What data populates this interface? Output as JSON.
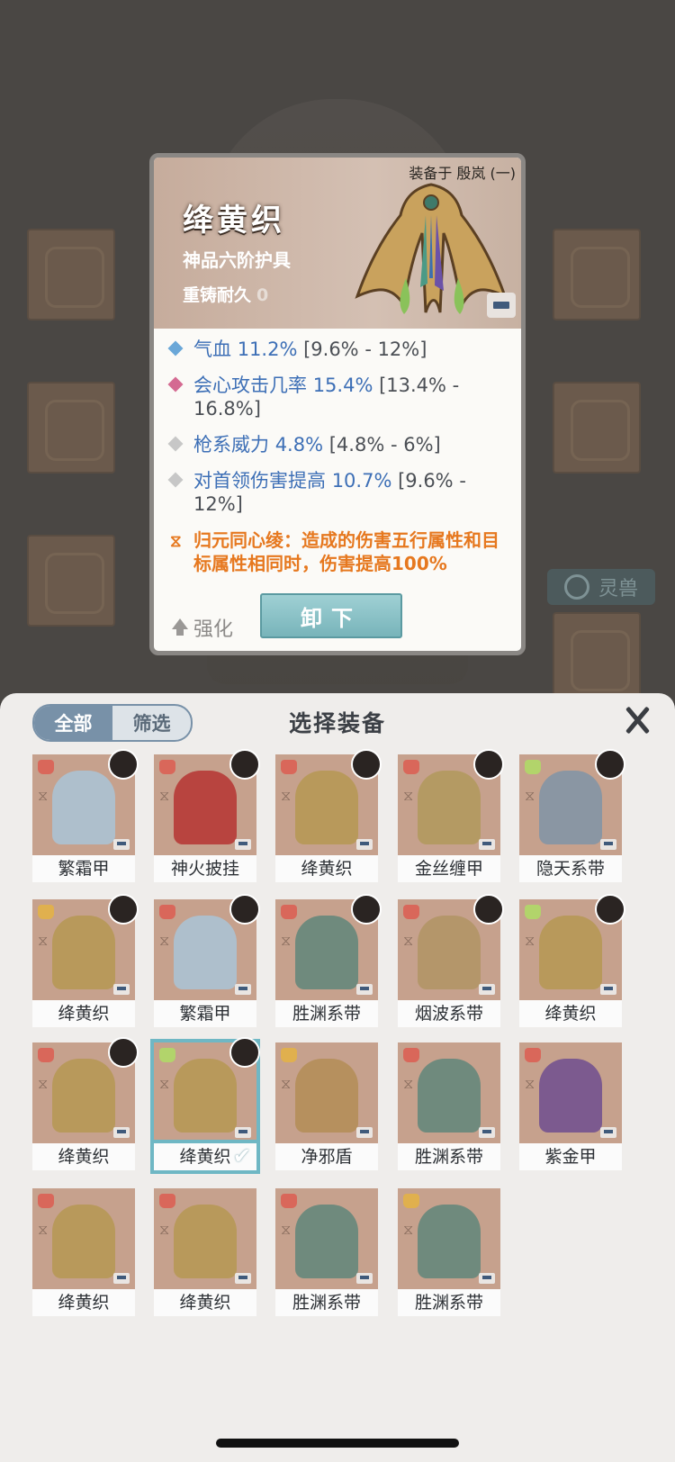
{
  "detail": {
    "equipped_on": "装备于 殷岚 (一)",
    "name": "绛黄织",
    "grade": "神品六阶护具",
    "durability_label": "重铸耐久",
    "durability_value": "0",
    "stats": [
      {
        "name": "气血",
        "value": "11.2%",
        "range": "[9.6% - 12%]",
        "color": "#6aa7d8"
      },
      {
        "name": "会心攻击几率",
        "value": "15.4%",
        "range": "[13.4% - 16.8%]",
        "color": "#d46a92"
      },
      {
        "name": "枪系威力",
        "value": "4.8%",
        "range": "[4.8% - 6%]",
        "color": "#c7c7c7"
      },
      {
        "name": "对首领伤害提高",
        "value": "10.7%",
        "range": "[9.6% - 12%]",
        "color": "#c7c7c7"
      }
    ],
    "set_bonus": "归元同心绫：造成的伤害五行属性和目标属性相同时，伤害提高100%",
    "enhance_label": "强化",
    "unequip_label": "卸下"
  },
  "background": {
    "pet_label": "灵兽"
  },
  "picker": {
    "title": "选择装备",
    "tabs": [
      "全部",
      "筛选"
    ],
    "items": [
      {
        "name": "繁霜甲",
        "art": "#aebfcc",
        "slot": "#d9675a",
        "avatar": true
      },
      {
        "name": "神火披挂",
        "art": "#b8443f",
        "slot": "#d9675a",
        "avatar": true
      },
      {
        "name": "绛黄织",
        "art": "#b8995b",
        "slot": "#d9675a",
        "avatar": true
      },
      {
        "name": "金丝缠甲",
        "art": "#b49a63",
        "slot": "#d9675a",
        "avatar": true
      },
      {
        "name": "隐天系带",
        "art": "#8a96a3",
        "slot": "#b2d46b",
        "avatar": true
      },
      {
        "name": "绛黄织",
        "art": "#b8995b",
        "slot": "#e0b04e",
        "avatar": true
      },
      {
        "name": "繁霜甲",
        "art": "#aebfcc",
        "slot": "#d9675a",
        "avatar": true
      },
      {
        "name": "胜渊系带",
        "art": "#6f8a7d",
        "slot": "#d9675a",
        "avatar": true
      },
      {
        "name": "烟波系带",
        "art": "#b4966a",
        "slot": "#d9675a",
        "avatar": true
      },
      {
        "name": "绛黄织",
        "art": "#b8995b",
        "slot": "#b2d46b",
        "avatar": true
      },
      {
        "name": "绛黄织",
        "art": "#b8995b",
        "slot": "#d9675a",
        "avatar": true
      },
      {
        "name": "绛黄织",
        "art": "#b8995b",
        "slot": "#b2d46b",
        "avatar": true,
        "selected": true
      },
      {
        "name": "净邪盾",
        "art": "#b6905e",
        "slot": "#e0b04e",
        "avatar": false
      },
      {
        "name": "胜渊系带",
        "art": "#6f8a7d",
        "slot": "#d9675a",
        "avatar": false
      },
      {
        "name": "紫金甲",
        "art": "#7c5a8f",
        "slot": "#d9675a",
        "avatar": false
      },
      {
        "name": "绛黄织",
        "art": "#b8995b",
        "slot": "#d9675a",
        "avatar": false
      },
      {
        "name": "绛黄织",
        "art": "#b8995b",
        "slot": "#d9675a",
        "avatar": false
      },
      {
        "name": "胜渊系带",
        "art": "#6f8a7d",
        "slot": "#d9675a",
        "avatar": false
      },
      {
        "name": "胜渊系带",
        "art": "#6f8a7d",
        "slot": "#e0b04e",
        "avatar": false
      }
    ]
  }
}
